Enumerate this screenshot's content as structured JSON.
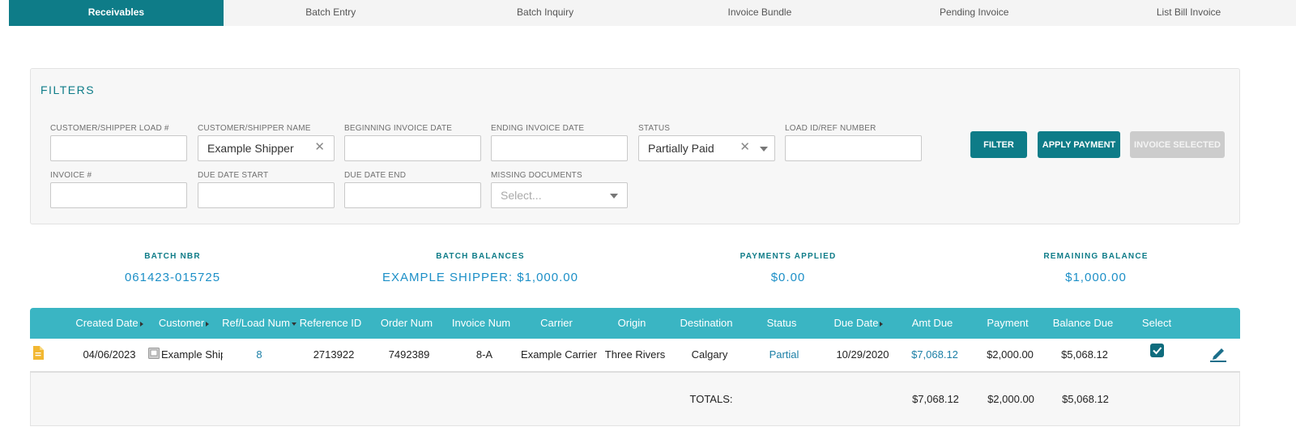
{
  "tabs": [
    {
      "label": "Receivables",
      "active": true
    },
    {
      "label": "Batch Entry",
      "active": false
    },
    {
      "label": "Batch Inquiry",
      "active": false
    },
    {
      "label": "Invoice Bundle",
      "active": false
    },
    {
      "label": "Pending Invoice",
      "active": false
    },
    {
      "label": "List Bill Invoice",
      "active": false
    }
  ],
  "filters": {
    "title": "FILTERS",
    "customer_load": {
      "label": "CUSTOMER/SHIPPER LOAD #",
      "value": ""
    },
    "customer_name": {
      "label": "CUSTOMER/SHIPPER NAME",
      "value": "Example Shipper"
    },
    "begin_date": {
      "label": "BEGINNING INVOICE DATE",
      "value": ""
    },
    "end_date": {
      "label": "ENDING INVOICE DATE",
      "value": ""
    },
    "status": {
      "label": "STATUS",
      "value": "Partially Paid"
    },
    "load_ref": {
      "label": "LOAD ID/REF NUMBER",
      "value": ""
    },
    "invoice_num": {
      "label": "INVOICE #",
      "value": ""
    },
    "due_start": {
      "label": "DUE DATE START",
      "value": ""
    },
    "due_end": {
      "label": "DUE DATE END",
      "value": ""
    },
    "missing_docs": {
      "label": "MISSING DOCUMENTS",
      "placeholder": "Select..."
    },
    "buttons": {
      "filter": "FILTER",
      "apply_payment": "APPLY PAYMENT",
      "invoice_selected": "INVOICE SELECTED"
    }
  },
  "summary": {
    "batch_nbr": {
      "label": "BATCH NBR",
      "value": "061423-015725"
    },
    "batch_balances": {
      "label": "BATCH BALANCES",
      "value": "EXAMPLE SHIPPER: $1,000.00"
    },
    "payments_applied": {
      "label": "PAYMENTS APPLIED",
      "value": "$0.00"
    },
    "remaining_balance": {
      "label": "REMAINING BALANCE",
      "value": "$1,000.00"
    }
  },
  "table": {
    "headers": {
      "created_date": "Created Date",
      "customer": "Customer",
      "ref_load": "Ref/Load Num",
      "reference_id": "Reference ID",
      "order_num": "Order Num",
      "invoice_num": "Invoice Num",
      "carrier": "Carrier",
      "origin": "Origin",
      "destination": "Destination",
      "status": "Status",
      "due_date": "Due Date",
      "amt_due": "Amt Due",
      "payment": "Payment",
      "balance_due": "Balance Due",
      "select": "Select"
    },
    "row": {
      "created_date": "04/06/2023",
      "customer": "Example Shipper",
      "ref_load": "8",
      "reference_id": "2713922",
      "order_num": "7492389",
      "invoice_num": "8-A",
      "carrier": "Example Carrier",
      "origin": "Three Rivers",
      "destination": "Calgary",
      "status": "Partial",
      "due_date": "10/29/2020",
      "amt_due": "$7,068.12",
      "payment": "$2,000.00",
      "balance_due": "$5,068.12",
      "selected": true
    },
    "totals": {
      "label": "TOTALS:",
      "amt_due": "$7,068.12",
      "payment": "$2,000.00",
      "balance_due": "$5,068.12"
    }
  },
  "colors": {
    "primary": "#0e7c88",
    "header": "#3ab5c3",
    "link": "#1c8fc7",
    "doc_icon": "#f2b731"
  }
}
